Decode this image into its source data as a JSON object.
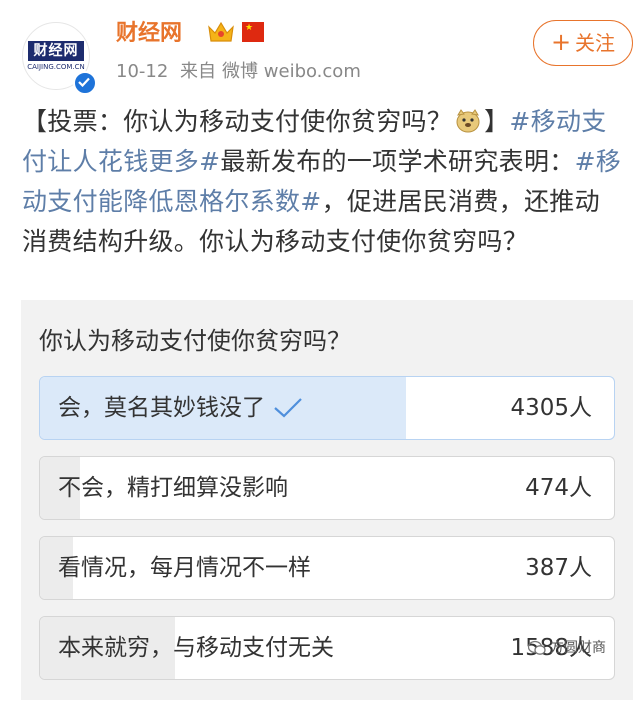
{
  "account": {
    "avatar_logo": "财经网",
    "avatar_sub": "CAIJING.COM.CN",
    "name": "财经网",
    "date": "10-12",
    "source_prefix": "来自",
    "source": "微博 weibo.com"
  },
  "follow_label": "关注",
  "post": {
    "segments": [
      {
        "text": "【投票：你认为移动支付使你贫穷吗？",
        "hashtag": false
      },
      {
        "text": "",
        "emoji": "doge-emoji-icon"
      },
      {
        "text": "】",
        "hashtag": false
      },
      {
        "text": "#移动支付让人花钱更多#",
        "hashtag": true
      },
      {
        "text": "最新发布的一项学术研究表明：",
        "hashtag": false
      },
      {
        "text": "#移动支付能降低恩格尔系数#",
        "hashtag": true
      },
      {
        "text": "，促进居民消费，还推动消费结构升级。你认为移动支付使你贫穷吗？",
        "hashtag": false
      }
    ]
  },
  "poll": {
    "question": "你认为移动支付使你贫穷吗？",
    "options": [
      {
        "label": "会，莫名其妙钱没了",
        "count": "4305人",
        "votes": 4305,
        "selected": true
      },
      {
        "label": "不会，精打细算没影响",
        "count": "474人",
        "votes": 474,
        "selected": false
      },
      {
        "label": "看情况，每月情况不一样",
        "count": "387人",
        "votes": 387,
        "selected": false
      },
      {
        "label": "本来就穷，与移动支付无关",
        "count": "1588人",
        "votes": 1588,
        "selected": false
      }
    ]
  },
  "watermark": "方圆财商",
  "colors": {
    "brand_orange": "#e8742c",
    "hashtag_blue": "#5e7ea8",
    "selected_fill": "#dbe9f9",
    "unselected_fill": "#ececec",
    "check_blue": "#4f8fdc"
  }
}
